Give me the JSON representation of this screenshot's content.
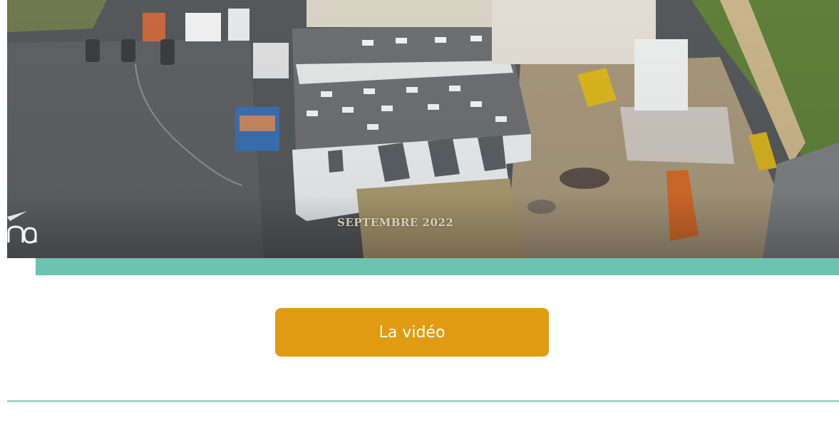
{
  "hero": {
    "caption": "SEPTEMBRE 2022"
  },
  "cta": {
    "label": "La vidéo"
  },
  "colors": {
    "teal": "#6cc3b1",
    "button": "#e09b12",
    "divider": "#9ed4c6"
  }
}
